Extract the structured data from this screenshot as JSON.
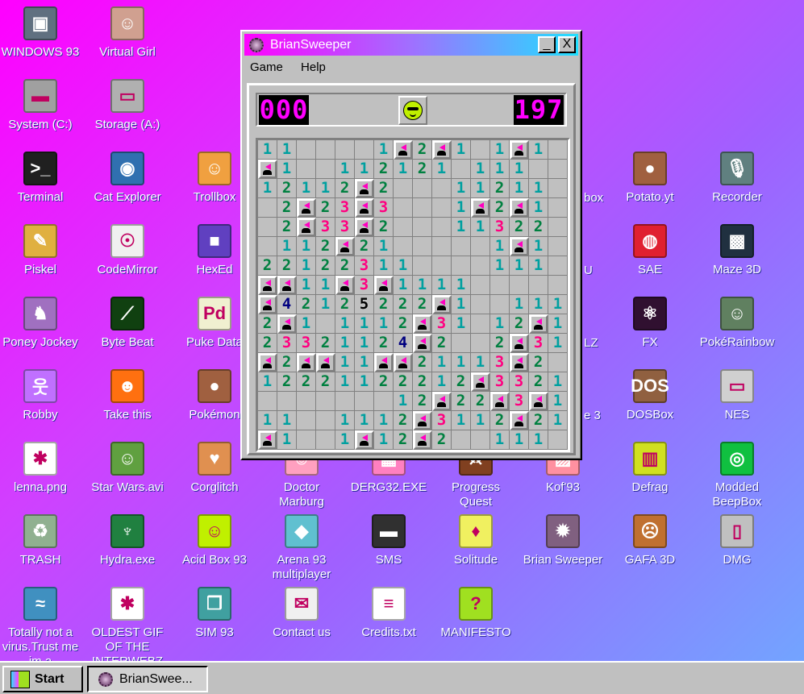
{
  "desktop": {
    "icons": [
      {
        "label": "WINDOWS 93",
        "icon": "computer-icon",
        "col": 0,
        "row": 0,
        "color": "#607080",
        "glyph": "▣"
      },
      {
        "label": "System (C:)",
        "icon": "hard-drive-icon",
        "col": 0,
        "row": 1,
        "color": "#a0a0a0",
        "glyph": "▬"
      },
      {
        "label": "Terminal",
        "icon": "terminal-icon",
        "col": 0,
        "row": 2,
        "color": "#202020",
        "glyph": ">_"
      },
      {
        "label": "Piskel",
        "icon": "palette-icon",
        "col": 0,
        "row": 3,
        "color": "#e0b040",
        "glyph": "✎"
      },
      {
        "label": "Poney Jockey",
        "icon": "pony-icon",
        "col": 0,
        "row": 4,
        "color": "#a070c0",
        "glyph": "♞"
      },
      {
        "label": "Robby",
        "icon": "stick-figure-icon",
        "col": 0,
        "row": 5,
        "color": "#c070ff",
        "glyph": "웃"
      },
      {
        "label": "lenna.png",
        "icon": "image-file-icon",
        "col": 0,
        "row": 6,
        "color": "#ffffff",
        "glyph": "✱"
      },
      {
        "label": "TRASH",
        "icon": "trash-icon",
        "col": 0,
        "row": 7,
        "color": "#90b090",
        "glyph": "♻"
      },
      {
        "label": "Totally not a virus.Trust me im a",
        "icon": "dolphin-icon",
        "col": 0,
        "row": 8,
        "color": "#4090c0",
        "glyph": "≈"
      },
      {
        "label": "Virtual Girl",
        "icon": "face-photo-icon",
        "col": 1,
        "row": 0,
        "color": "#d0a090",
        "glyph": "☺"
      },
      {
        "label": "Storage (A:)",
        "icon": "floppy-drive-icon",
        "col": 1,
        "row": 1,
        "color": "#b0b0b0",
        "glyph": "▭"
      },
      {
        "label": "Cat Explorer",
        "icon": "globe-cat-icon",
        "col": 1,
        "row": 2,
        "color": "#3070b0",
        "glyph": "◉"
      },
      {
        "label": "CodeMirror",
        "icon": "cat-icon",
        "col": 1,
        "row": 3,
        "color": "#f0f0f0",
        "glyph": "☉"
      },
      {
        "label": "Byte Beat",
        "icon": "bytebeat-icon",
        "col": 1,
        "row": 4,
        "color": "#104010",
        "glyph": "⟋"
      },
      {
        "label": "Take this",
        "icon": "pixel-character-icon",
        "col": 1,
        "row": 5,
        "color": "#ff7010",
        "glyph": "☻"
      },
      {
        "label": "Star Wars.avi",
        "icon": "yoda-icon",
        "col": 1,
        "row": 6,
        "color": "#60a040",
        "glyph": "☺"
      },
      {
        "label": "Hydra.exe",
        "icon": "hydra-icon",
        "col": 1,
        "row": 7,
        "color": "#208040",
        "glyph": "♆"
      },
      {
        "label": "OLDEST GIF OF THE INTERWEBZ",
        "icon": "gif-file-icon",
        "col": 1,
        "row": 8,
        "color": "#ffffff",
        "glyph": "✱"
      },
      {
        "label": "Trollbox",
        "icon": "trollbox-icon",
        "col": 2,
        "row": 2,
        "color": "#f0a040",
        "glyph": "☺"
      },
      {
        "label": "HexEd",
        "icon": "cube-icon",
        "col": 2,
        "row": 3,
        "color": "#6040c0",
        "glyph": "■"
      },
      {
        "label": "Puke Data",
        "icon": "pd-icon",
        "col": 2,
        "row": 4,
        "color": "#f0f0d0",
        "glyph": "Pd"
      },
      {
        "label": "Pokémon",
        "icon": "rock-icon",
        "col": 2,
        "row": 5,
        "color": "#a06040",
        "glyph": "●"
      },
      {
        "label": "Corglitch",
        "icon": "corgi-icon",
        "col": 2,
        "row": 6,
        "color": "#e09050",
        "glyph": "♥"
      },
      {
        "label": "Acid Box 93",
        "icon": "smiley-icon",
        "col": 2,
        "row": 7,
        "color": "#c0f000",
        "glyph": "☺"
      },
      {
        "label": "SIM 93",
        "icon": "book-icon",
        "col": 2,
        "row": 8,
        "color": "#40a0a0",
        "glyph": "❒"
      },
      {
        "label": "Doctor Marburg",
        "icon": "doctor-icon",
        "col": 3,
        "row": 6,
        "color": "#ffa0c0",
        "glyph": "☺"
      },
      {
        "label": "Arena 93 multiplayer",
        "icon": "cube-color-icon",
        "col": 3,
        "row": 7,
        "color": "#60c0d0",
        "glyph": "◆"
      },
      {
        "label": "Contact us",
        "icon": "letter-icon",
        "col": 3,
        "row": 8,
        "color": "#f0f0f0",
        "glyph": "✉"
      },
      {
        "label": "DERG32.EXE",
        "icon": "derg-icon",
        "col": 4,
        "row": 6,
        "color": "#ff80c0",
        "glyph": "▦"
      },
      {
        "label": "SMS",
        "icon": "console-icon",
        "col": 4,
        "row": 7,
        "color": "#303030",
        "glyph": "▬"
      },
      {
        "label": "Credits.txt",
        "icon": "text-file-icon",
        "col": 4,
        "row": 8,
        "color": "#ffffff",
        "glyph": "≡"
      },
      {
        "label": "Progress Quest",
        "icon": "swords-icon",
        "col": 5,
        "row": 6,
        "color": "#804020",
        "glyph": "⚔"
      },
      {
        "label": "Solitude",
        "icon": "bottle-icon",
        "col": 5,
        "row": 7,
        "color": "#f0f060",
        "glyph": "♦"
      },
      {
        "label": "MANIFESTO",
        "icon": "question-icon",
        "col": 5,
        "row": 8,
        "color": "#a0e020",
        "glyph": "?"
      },
      {
        "label": "Kof'93",
        "icon": "kof-icon",
        "col": 6,
        "row": 6,
        "color": "#ff90a0",
        "glyph": "▨"
      },
      {
        "label": "Brian Sweeper",
        "icon": "mine-icon",
        "col": 6,
        "row": 7,
        "color": "#806080",
        "glyph": "✹"
      },
      {
        "label": "Potato.yt",
        "icon": "potato-icon",
        "col": 7,
        "row": 2,
        "color": "#a06040",
        "glyph": "●"
      },
      {
        "label": "SAE",
        "icon": "checker-ball-icon",
        "col": 7,
        "row": 3,
        "color": "#e02030",
        "glyph": "◍"
      },
      {
        "label": "FX",
        "icon": "atom-icon",
        "col": 7,
        "row": 4,
        "color": "#301030",
        "glyph": "⚛"
      },
      {
        "label": "DOSBox",
        "icon": "dosbox-icon",
        "col": 7,
        "row": 5,
        "color": "#906040",
        "glyph": "DOS"
      },
      {
        "label": "Defrag",
        "icon": "defrag-icon",
        "col": 7,
        "row": 6,
        "color": "#d0e020",
        "glyph": "▥"
      },
      {
        "label": "GAFA 3D",
        "icon": "doom-face-icon",
        "col": 7,
        "row": 7,
        "color": "#c07030",
        "glyph": "☹"
      },
      {
        "label": "Recorder",
        "icon": "microphone-icon",
        "col": 8,
        "row": 2,
        "color": "#608080",
        "glyph": "🎙"
      },
      {
        "label": "Maze 3D",
        "icon": "maze-icon",
        "col": 8,
        "row": 3,
        "color": "#203040",
        "glyph": "▩"
      },
      {
        "label": "PokéRainbow",
        "icon": "pokemon-trainers-icon",
        "col": 8,
        "row": 4,
        "color": "#608060",
        "glyph": "☺"
      },
      {
        "label": "NES",
        "icon": "nes-icon",
        "col": 8,
        "row": 5,
        "color": "#d0d0d0",
        "glyph": "▭"
      },
      {
        "label": "Modded BeepBox",
        "icon": "ring-icon",
        "col": 8,
        "row": 6,
        "color": "#10c040",
        "glyph": "◎"
      },
      {
        "label": "DMG",
        "icon": "gameboy-icon",
        "col": 8,
        "row": 7,
        "color": "#c0c0c0",
        "glyph": "▯"
      }
    ],
    "partial_labels": [
      "box",
      "U",
      "LZ",
      "e 3"
    ]
  },
  "window": {
    "title": "BrianSweeper",
    "menu": [
      "Game",
      "Help"
    ],
    "minimize": "_",
    "close": "X",
    "mine_counter": "000",
    "timer": "197",
    "face": "sunglasses-smiley-icon",
    "grid_rows": [
      "11....1F2F1.1F1.",
      "F1..11212 1.111.",
      "12112F2...11211.",
      ".2F23F3...1F2F1.",
      ".2F33F2...11322.",
      ".112F21.....1F1.",
      "22122311....111.",
      "FF11F3F1111.....",
      "F42125222F1..111",
      "2F1.1112F31.12F1",
      "23321124F2..2F31",
      "F2FF11FF21113F2.",
      "1222112221 2F3321",
      ".......12F22F3F1",
      "11..1112F3112F21",
      "F1..1F12F2..111."
    ],
    "number_colors": {
      "1": "#00a0a0",
      "2": "#008040",
      "3": "#ff0080",
      "4": "#000080"
    },
    "flag_color": "#ff00c0"
  },
  "taskbar": {
    "start_label": "Start",
    "tasks": [
      {
        "label": "BrianSwee...",
        "icon": "mine-icon"
      }
    ]
  }
}
